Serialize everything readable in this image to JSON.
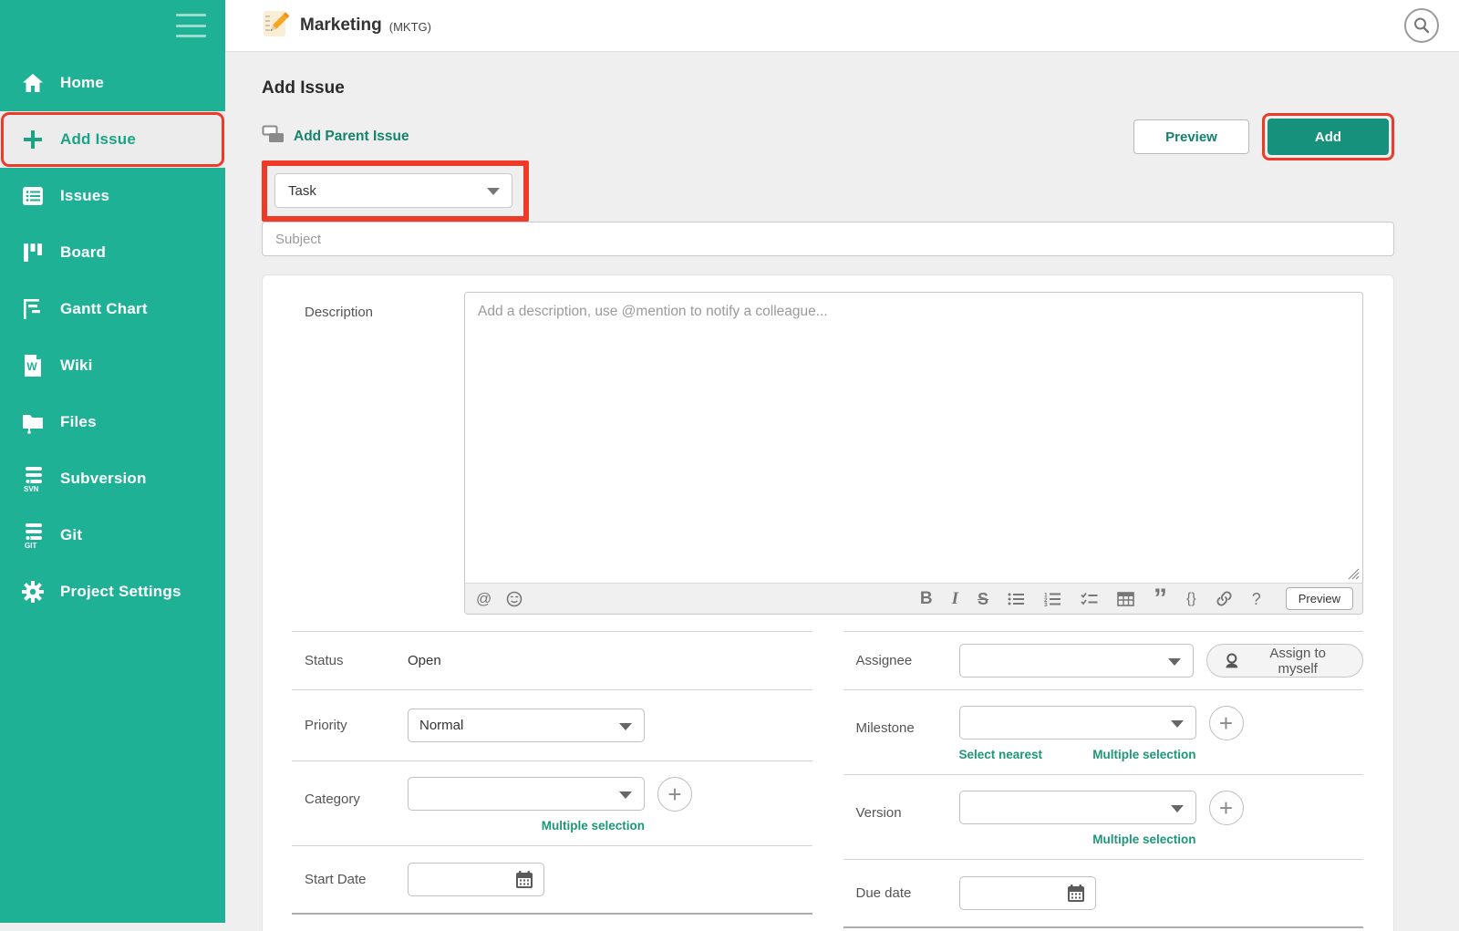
{
  "colors": {
    "sidebar_green": "#1FB195",
    "button_green": "#16917B",
    "link_teal": "#17836C",
    "annotation_red": "#EE3A28"
  },
  "sidebar": {
    "items": [
      {
        "label": "Home",
        "icon": "home-icon",
        "selected": false
      },
      {
        "label": "Add Issue",
        "icon": "plus-icon",
        "selected": true,
        "annotated": true
      },
      {
        "label": "Issues",
        "icon": "issues-icon",
        "selected": false
      },
      {
        "label": "Board",
        "icon": "board-icon",
        "selected": false
      },
      {
        "label": "Gantt Chart",
        "icon": "gantt-icon",
        "selected": false
      },
      {
        "label": "Wiki",
        "icon": "wiki-icon",
        "selected": false
      },
      {
        "label": "Files",
        "icon": "files-icon",
        "selected": false
      },
      {
        "label": "Subversion",
        "icon": "svn-icon",
        "badge": "SVN",
        "selected": false
      },
      {
        "label": "Git",
        "icon": "git-icon",
        "badge": "GIT",
        "selected": false
      },
      {
        "label": "Project Settings",
        "icon": "gear-icon",
        "selected": false
      }
    ]
  },
  "header": {
    "project_name": "Marketing",
    "project_key": "(MKTG)"
  },
  "page": {
    "title": "Add Issue",
    "add_parent_issue": "Add Parent Issue",
    "preview_button": "Preview",
    "add_button": "Add",
    "issue_type": "Task",
    "subject_placeholder": "Subject"
  },
  "editor": {
    "label": "Description",
    "placeholder": "Add a description, use @mention to notify a colleague...",
    "preview_button": "Preview",
    "icons": {
      "mention": "@",
      "emoji": "☺",
      "bold": "B",
      "italic": "I",
      "strike": "S",
      "quote": "”",
      "braces": "{}",
      "help": "?"
    }
  },
  "form": {
    "status": {
      "label": "Status",
      "value": "Open"
    },
    "priority": {
      "label": "Priority",
      "value": "Normal"
    },
    "category": {
      "label": "Category",
      "multiple_selection": "Multiple selection"
    },
    "start_date": {
      "label": "Start Date",
      "value": ""
    },
    "assignee": {
      "label": "Assignee",
      "value": "",
      "assign_to_myself": "Assign to myself"
    },
    "milestone": {
      "label": "Milestone",
      "value": "",
      "select_nearest": "Select nearest",
      "multiple_selection": "Multiple selection"
    },
    "version": {
      "label": "Version",
      "value": "",
      "multiple_selection": "Multiple selection"
    },
    "due_date": {
      "label": "Due date",
      "value": ""
    }
  }
}
